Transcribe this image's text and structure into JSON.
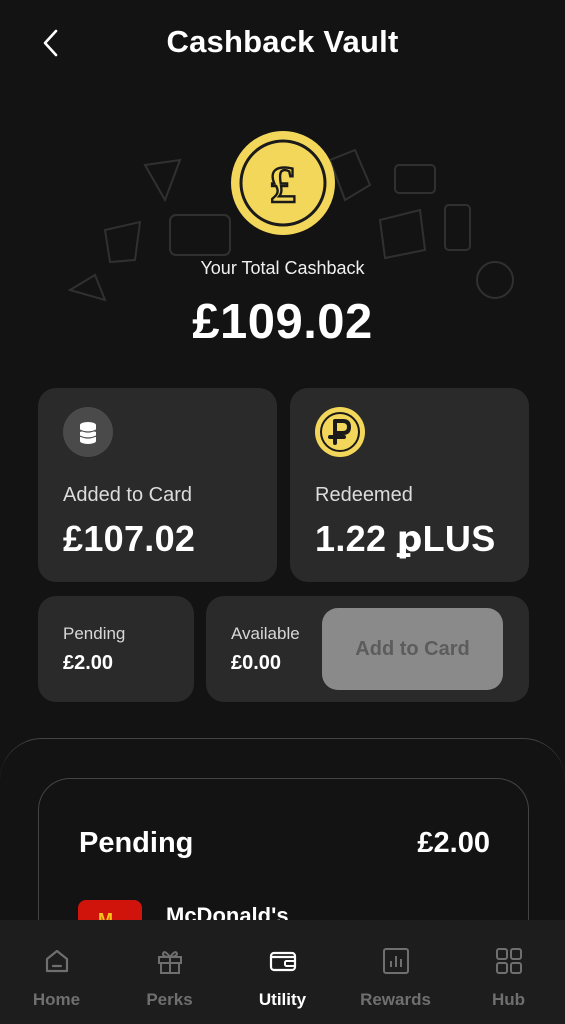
{
  "header": {
    "title": "Cashback Vault",
    "back_icon": "chevron-left-icon"
  },
  "hero": {
    "coin_icon": "pound-coin-icon",
    "total_label": "Your Total Cashback",
    "total_value": "£109.02"
  },
  "cards": {
    "added": {
      "icon": "coins-stack-icon",
      "label": "Added to Card",
      "value": "£107.02"
    },
    "redeemed": {
      "icon": "plus-coin-icon",
      "label": "Redeemed",
      "value": "1.22 ꝑLUS"
    },
    "pending": {
      "label": "Pending",
      "value": "£2.00"
    },
    "available": {
      "label": "Available",
      "value": "£0.00",
      "button_label": "Add to Card"
    }
  },
  "pending_panel": {
    "title": "Pending",
    "total": "£2.00",
    "items": [
      {
        "merchant": "McDonald's",
        "logo_icon": "mcdonalds-logo"
      }
    ]
  },
  "nav": {
    "items": [
      {
        "label": "Home",
        "icon": "home-icon",
        "active": false
      },
      {
        "label": "Perks",
        "icon": "gift-icon",
        "active": false
      },
      {
        "label": "Utility",
        "icon": "wallet-icon",
        "active": true
      },
      {
        "label": "Rewards",
        "icon": "chart-icon",
        "active": false
      },
      {
        "label": "Hub",
        "icon": "grid-icon",
        "active": false
      }
    ]
  },
  "colors": {
    "background": "#131313",
    "card": "#2a2a2a",
    "coin_gold": "#f3d75a",
    "button_disabled": "#8a8a8a",
    "nav_inactive": "#6f6f6f",
    "mcdonalds_red": "#d0140b"
  }
}
